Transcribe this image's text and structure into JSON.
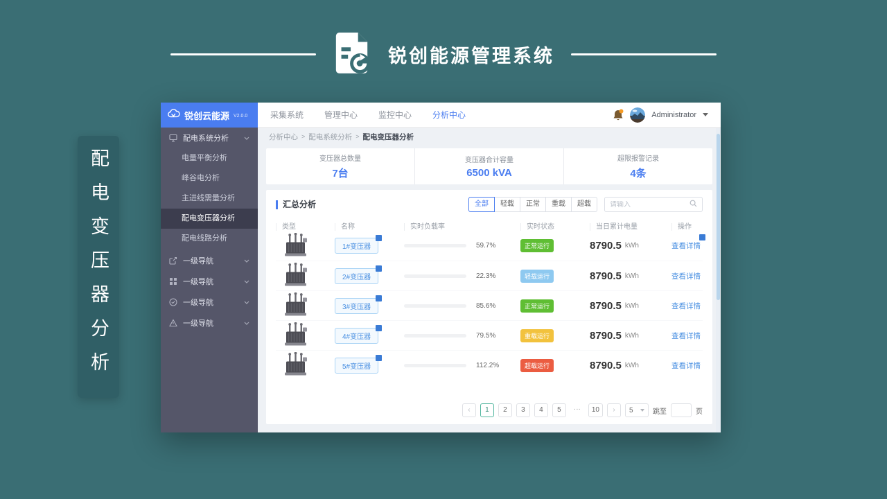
{
  "banner": {
    "title": "锐创能源管理系统",
    "icon": "document-refresh-icon"
  },
  "side_label": {
    "text": "配电变压器分析"
  },
  "app": {
    "sidebar": {
      "logo": {
        "name": "锐创云能源",
        "version": "V2.0.0",
        "icon": "cloud-icon"
      },
      "group_main": {
        "label": "配电系统分析",
        "icon": "monitor-icon"
      },
      "submenu": [
        {
          "label": "电量平衡分析",
          "active": false
        },
        {
          "label": "峰谷电分析",
          "active": false
        },
        {
          "label": "主进线需量分析",
          "active": false
        },
        {
          "label": "配电变压器分析",
          "active": true
        },
        {
          "label": "配电线路分析",
          "active": false
        }
      ],
      "groups_rest": [
        {
          "label": "一级导航",
          "icon": "external-link-icon"
        },
        {
          "label": "一级导航",
          "icon": "grid-icon"
        },
        {
          "label": "一级导航",
          "icon": "check-circle-icon"
        },
        {
          "label": "一级导航",
          "icon": "warning-triangle-icon"
        }
      ]
    },
    "topnav": {
      "items": [
        {
          "label": "采集系统",
          "active": false
        },
        {
          "label": "管理中心",
          "active": false
        },
        {
          "label": "监控中心",
          "active": false
        },
        {
          "label": "分析中心",
          "active": true
        }
      ],
      "user": {
        "name": "Administrator"
      }
    },
    "breadcrumb": {
      "items": [
        "分析中心",
        "配电系统分析",
        "配电变压器分析"
      ],
      "separator": ">"
    },
    "stats": [
      {
        "label": "变压器总数量",
        "value": "7台"
      },
      {
        "label": "变压器合计容量",
        "value": "6500 kVA"
      },
      {
        "label": "超限报警记录",
        "value": "4条"
      }
    ],
    "panel": {
      "title": "汇总分析",
      "filters": [
        "全部",
        "轻载",
        "正常",
        "重载",
        "超载"
      ],
      "active_filter": "全部",
      "search_placeholder": "请输入"
    },
    "table": {
      "headers": [
        "类型",
        "名称",
        "实时负载率",
        "实时状态",
        "当日累计电量",
        "操作"
      ],
      "action_label": "查看详情",
      "energy_unit": "kWh",
      "status_colors": {
        "normal": "#5fbe33",
        "light": "#8ec9f0",
        "heavy": "#f2c23d",
        "over": "#eb5c41"
      },
      "rows": [
        {
          "name": "1#变压器",
          "load": "59.7%",
          "load_pct": 59.7,
          "status": "正常运行",
          "status_type": "normal",
          "energy": "8790.5",
          "action_badge": true
        },
        {
          "name": "2#变压器",
          "load": "22.3%",
          "load_pct": 22.3,
          "status": "轻载运行",
          "status_type": "light",
          "energy": "8790.5",
          "action_badge": false
        },
        {
          "name": "3#变压器",
          "load": "85.6%",
          "load_pct": 85.6,
          "status": "正常运行",
          "status_type": "normal",
          "energy": "8790.5",
          "action_badge": false
        },
        {
          "name": "4#变压器",
          "load": "79.5%",
          "load_pct": 79.5,
          "status": "重载运行",
          "status_type": "heavy",
          "energy": "8790.5",
          "action_badge": false
        },
        {
          "name": "5#变压器",
          "load": "112.2%",
          "load_pct": 112.2,
          "status": "超载运行",
          "status_type": "over",
          "energy": "8790.5",
          "action_badge": false
        }
      ]
    },
    "pagination": {
      "prev": "‹",
      "next": "›",
      "pages": [
        "1",
        "2",
        "3",
        "4",
        "5",
        "···",
        "10"
      ],
      "active_page": "1",
      "page_size": "5",
      "jump_label": "跳至",
      "jump_suffix": "页"
    },
    "accent_colors": {
      "primary_blue": "#4a7df0",
      "link_blue": "#4a90e2",
      "progress_blue": "#2d8cf0",
      "pagination_active": "#54b7a0"
    }
  }
}
